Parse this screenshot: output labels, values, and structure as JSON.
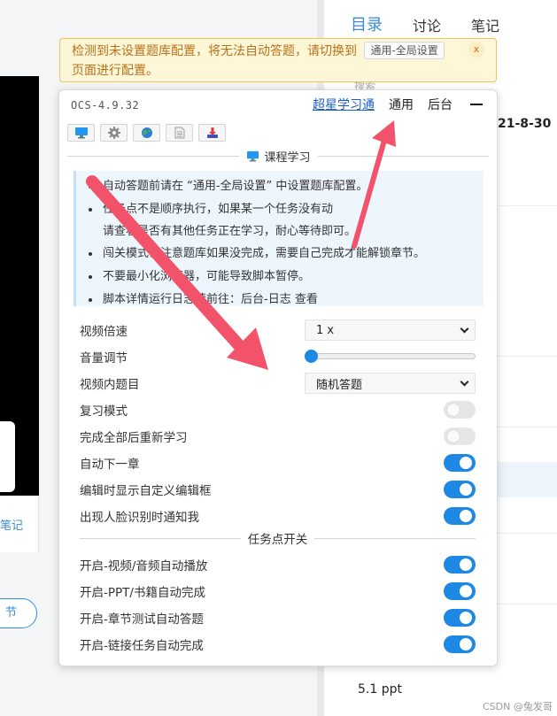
{
  "background": {
    "tabs": [
      "目录",
      "讨论",
      "笔记"
    ],
    "search_text": "搜索",
    "date_text": "21-8-30",
    "notes_link": "笔记",
    "chapter_button": "节",
    "bottom_item": "5.1 ppt",
    "watermark": "CSDN @兔发哥"
  },
  "warning": {
    "message_part1": "检测到未设置题库配置，将无法自动答题，请切换到",
    "button": "通用-全局设置",
    "message_part2": "页面进行配置。",
    "close": "x"
  },
  "panel": {
    "version": "OCS-4.9.32",
    "nav": [
      "超星学习通",
      "通用",
      "后台"
    ],
    "toolbar_icons": [
      "monitor-icon",
      "gear-icon",
      "globe-icon",
      "document-icon",
      "download-icon"
    ],
    "section_title": "课程学习",
    "notices": [
      "自动答题前请在 “通用-全局设置” 中设置题库配置。",
      "任务点不是顺序执行，如果某一个任务没有动",
      "请查看是否有其他任务正在学习，耐心等待即可。",
      "闯关模式请注意题库如果没完成，需要自己完成才能解锁章节。",
      "不要最小化浏览器，可能导致脚本暂停。",
      "脚本详情运行日志请前往：后台-日志 查看"
    ],
    "settings": {
      "playback_rate": {
        "label": "视频倍速",
        "value": "1 x"
      },
      "volume": {
        "label": "音量调节",
        "value": 0
      },
      "video_question": {
        "label": "视频内题目",
        "value": "随机答题"
      },
      "review_mode": {
        "label": "复习模式",
        "on": false
      },
      "restudy": {
        "label": "完成全部后重新学习",
        "on": false
      },
      "next_chapter": {
        "label": "自动下一章",
        "on": true
      },
      "custom_editor": {
        "label": "编辑时显示自定义编辑框",
        "on": true
      },
      "face_notify": {
        "label": "出现人脸识别时通知我",
        "on": true
      }
    },
    "task_section_title": "任务点开关",
    "tasks": [
      {
        "label": "开启-视频/音频自动播放",
        "on": true
      },
      {
        "label": "开启-PPT/书籍自动完成",
        "on": true
      },
      {
        "label": "开启-章节测试自动答题",
        "on": true
      },
      {
        "label": "开启-链接任务自动完成",
        "on": true
      }
    ]
  },
  "colors": {
    "accent": "#1e88e5",
    "warning_bg": "#fdf6d7",
    "warning_text": "#b9711a",
    "arrow": "#f2536b"
  }
}
